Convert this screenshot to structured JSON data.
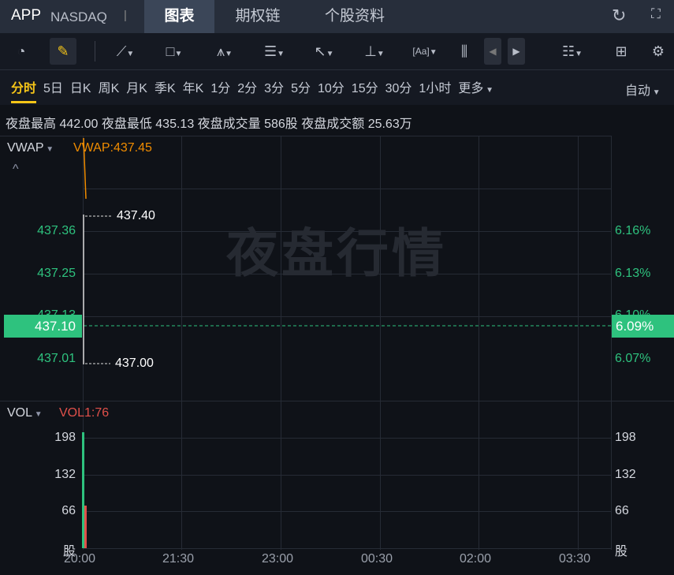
{
  "header": {
    "symbol": "APP",
    "exchange": "NASDAQ",
    "separator": "|",
    "tabs": [
      {
        "label": "图表",
        "active": true
      },
      {
        "label": "期权链"
      },
      {
        "label": "个股资料"
      }
    ],
    "refresh_icon": "refresh-icon",
    "fullscreen_icon": "fullscreen-icon"
  },
  "toolbar": {
    "icons": [
      "speedometer-icon",
      "pencil-icon",
      "line-icon",
      "rectangle-icon",
      "pattern-icon",
      "fib-icon",
      "arrow-icon",
      "measure-icon",
      "text-icon",
      "candles-icon",
      "prev-icon",
      "next-icon",
      "list-layout-icon",
      "grid-icon",
      "gear-icon"
    ],
    "accent": "#f5c518"
  },
  "periods": {
    "items": [
      "分时",
      "5日",
      "日K",
      "周K",
      "月K",
      "季K",
      "年K",
      "1分",
      "2分",
      "3分",
      "5分",
      "10分",
      "15分",
      "30分",
      "1小时",
      "更多"
    ],
    "active": "分时",
    "auto": "自动"
  },
  "info": {
    "text": "夜盘最高 442.00 夜盘最低 435.13 夜盘成交量 586股 夜盘成交额 25.63万"
  },
  "watermark": "夜盘行情",
  "main": {
    "indicator": "VWAP",
    "indicator_value": "VWAP:437.45",
    "high_label": "437.40",
    "low_label": "437.00",
    "current": "437.10",
    "current_pct": "6.09%",
    "y_ticks": [
      "437.36",
      "437.25",
      "437.13",
      "437.01"
    ],
    "pct_ticks": [
      "6.16%",
      "6.13%",
      "6.10%",
      "6.07%"
    ]
  },
  "volume": {
    "indicator": "VOL",
    "indicator_value": "VOL1:76",
    "y_ticks": [
      "198",
      "132",
      "66",
      "股"
    ]
  },
  "x_ticks": [
    "20:00",
    "21:30",
    "23:00",
    "00:30",
    "02:00",
    "03:30"
  ],
  "colors": {
    "up": "#2ec27e",
    "down": "#e0504a",
    "vwap": "#f08c00"
  }
}
